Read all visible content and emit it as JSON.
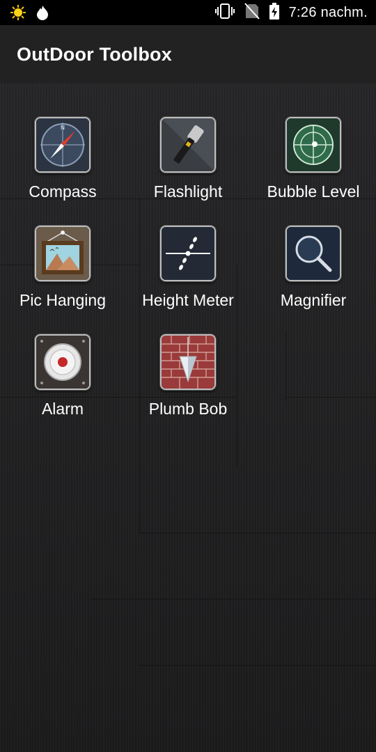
{
  "status_bar": {
    "time": "7:26 nachm.",
    "icons": [
      "weather-sun-icon",
      "fire-drop-icon",
      "vibrate-icon",
      "no-sim-icon",
      "battery-charging-icon"
    ]
  },
  "app_bar": {
    "title": "OutDoor Toolbox"
  },
  "tools": [
    {
      "label": "Compass",
      "icon": "compass-icon"
    },
    {
      "label": "Flashlight",
      "icon": "flashlight-icon"
    },
    {
      "label": "Bubble Level",
      "icon": "bubble-level-icon"
    },
    {
      "label": "Pic Hanging",
      "icon": "picture-frame-icon"
    },
    {
      "label": "Height Meter",
      "icon": "height-meter-icon"
    },
    {
      "label": "Magnifier",
      "icon": "magnifier-icon"
    },
    {
      "label": "Alarm",
      "icon": "alarm-bell-icon"
    },
    {
      "label": "Plumb Bob",
      "icon": "plumb-bob-icon"
    }
  ]
}
